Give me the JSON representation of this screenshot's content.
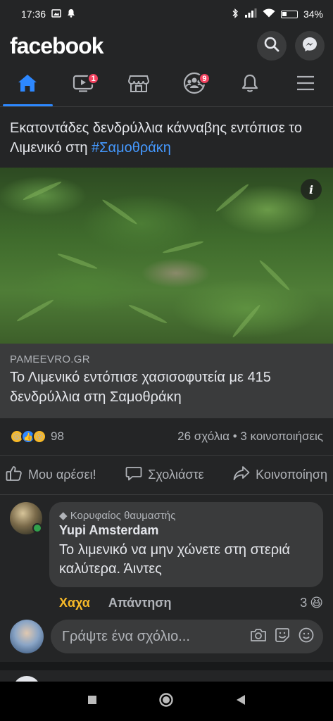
{
  "status_bar": {
    "time": "17:36",
    "battery": "34%"
  },
  "header": {
    "logo": "facebook",
    "search_icon": "search-icon",
    "messenger_icon": "messenger-icon"
  },
  "nav": {
    "items": [
      {
        "name": "home",
        "icon": "home-icon",
        "active": true
      },
      {
        "name": "watch",
        "icon": "video-icon",
        "badge": "1"
      },
      {
        "name": "marketplace",
        "icon": "store-icon"
      },
      {
        "name": "groups",
        "icon": "groups-icon",
        "badge": "9"
      },
      {
        "name": "notifications",
        "icon": "bell-icon"
      },
      {
        "name": "menu",
        "icon": "menu-icon"
      }
    ]
  },
  "post": {
    "text_main": "Εκατοντάδες δενδρύλλια κάνναβης εντόπισε το Λιμενικό στη ",
    "hashtag": "#Σαμοθράκη",
    "link": {
      "domain": "PAMEEVRO.GR",
      "title": "Το Λιμενικό εντόπισε χασισοφυτεία με 415 δενδρύλλια στη Σαμοθράκη"
    },
    "reactions_count": "98",
    "stats": "26 σχόλια • 3 κοινοποιήσεις",
    "actions": {
      "like": "Μου αρέσει!",
      "comment": "Σχολιάστε",
      "share": "Κοινοποίηση"
    }
  },
  "comment": {
    "badge": "Κορυφαίος θαυμαστής",
    "author": "Yupi Amsterdam",
    "text": "Το λιμενικό να μην χώνετε στη στεριά καλύτερα. Άιντες",
    "reaction_label": "Χαχα",
    "reply_label": "Απάντηση",
    "reaction_count": "3"
  },
  "composer": {
    "placeholder": "Γράψτε ένα σχόλιο..."
  },
  "colors": {
    "accent": "#2d88ff",
    "badge_red": "#f3425f",
    "haha_yellow": "#f7b928",
    "background": "#18191a",
    "surface": "#242526"
  }
}
